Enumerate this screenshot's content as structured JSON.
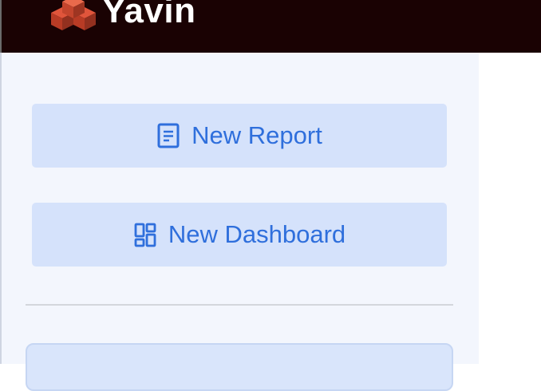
{
  "header": {
    "app_name": "Yavin",
    "logo_icon": "stacked-cubes-logo",
    "background_color": "#1a0203"
  },
  "sidebar": {
    "background_color": "#f3f6fd",
    "actions": [
      {
        "label": "New Report",
        "icon": "document-icon"
      },
      {
        "label": "New Dashboard",
        "icon": "dashboard-icon"
      }
    ]
  },
  "colors": {
    "accent": "#2f6fdc",
    "button_bg": "#d5e2fb"
  }
}
